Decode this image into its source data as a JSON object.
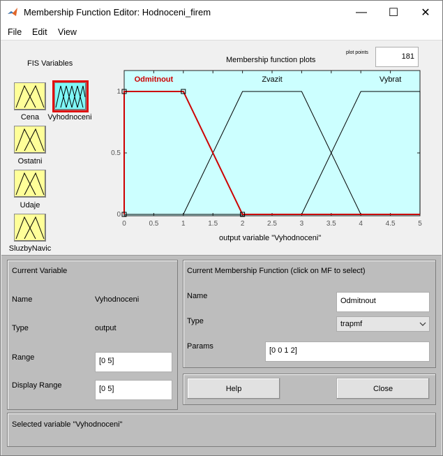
{
  "window": {
    "title": "Membership Function Editor: Hodnoceni_firem",
    "minimize_glyph": "—",
    "maximize_glyph": "☐",
    "close_glyph": "✕"
  },
  "menu": [
    "File",
    "Edit",
    "View"
  ],
  "fis_variables": {
    "heading": "FIS Variables",
    "items": [
      {
        "name": "Cena",
        "kind": "input"
      },
      {
        "name": "Vyhodnoceni",
        "kind": "output",
        "selected": true
      },
      {
        "name": "Ostatni",
        "kind": "input"
      },
      {
        "name": "Udaje",
        "kind": "input"
      },
      {
        "name": "SluzbyNavic",
        "kind": "input"
      }
    ]
  },
  "plot": {
    "title": "Membership function plots",
    "plot_points_label": "plot points",
    "plot_points_value": "181",
    "xlabel": "output variable \"Vyhodnoceni\"",
    "background_color": "#ccffff",
    "selected_color": "#cc0000"
  },
  "chart_data": {
    "type": "line",
    "xlim": [
      0,
      5
    ],
    "ylim": [
      0,
      1
    ],
    "x_ticks": [
      "0",
      "0.5",
      "1",
      "1.5",
      "2",
      "2.5",
      "3",
      "3.5",
      "4",
      "4.5",
      "5"
    ],
    "y_ticks": [
      "0",
      "0.5",
      "1"
    ],
    "series": [
      {
        "name": "Odmitnout",
        "type": "trapmf",
        "params": [
          0,
          0,
          1,
          2
        ],
        "selected": true
      },
      {
        "name": "Zvazit",
        "type": "trapmf",
        "params": [
          1,
          2,
          3,
          4
        ],
        "selected": false
      },
      {
        "name": "Vybrat",
        "type": "trapmf",
        "params": [
          3,
          4,
          5,
          5
        ],
        "selected": false
      }
    ]
  },
  "current_variable": {
    "heading": "Current Variable",
    "name_label": "Name",
    "name_value": "Vyhodnoceni",
    "type_label": "Type",
    "type_value": "output",
    "range_label": "Range",
    "range_value": "[0 5]",
    "display_range_label": "Display Range",
    "display_range_value": "[0 5]"
  },
  "current_mf": {
    "heading": "Current Membership Function (click on MF to select)",
    "name_label": "Name",
    "name_value": "Odmitnout",
    "type_label": "Type",
    "type_value": "trapmf",
    "params_label": "Params",
    "params_value": "[0 0 1 2]"
  },
  "buttons": {
    "help": "Help",
    "close": "Close"
  },
  "status": "Selected variable \"Vyhodnoceni\""
}
